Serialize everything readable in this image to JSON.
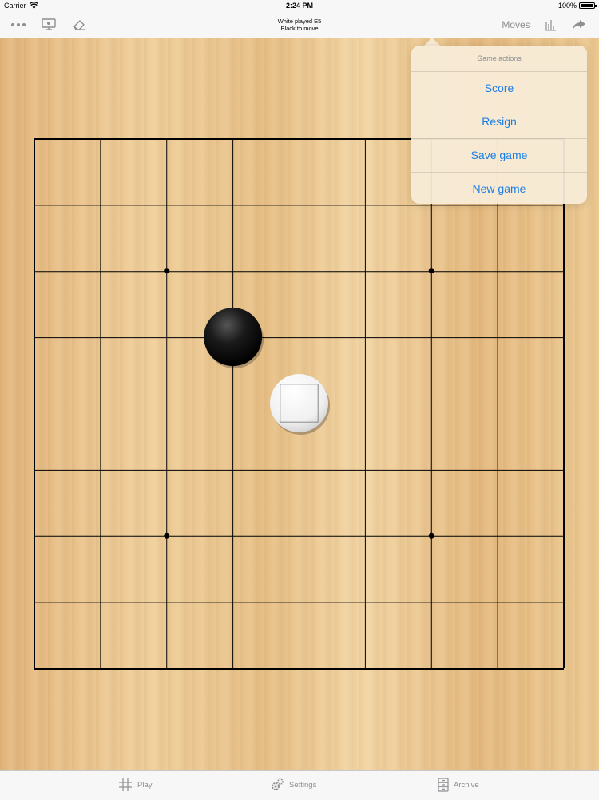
{
  "status_bar": {
    "carrier": "Carrier",
    "time": "2:24 PM",
    "battery": "100%"
  },
  "nav": {
    "title_line1": "White played E5",
    "title_line2": "Black to move",
    "moves_label": "Moves",
    "icons": [
      "more-icon",
      "display-icon",
      "eraser-icon",
      "chart-icon",
      "share-icon"
    ]
  },
  "popover": {
    "header": "Game actions",
    "items": [
      "Score",
      "Resign",
      "Save game",
      "New game"
    ]
  },
  "tabs": {
    "play": "Play",
    "settings": "Settings",
    "archive": "Archive"
  },
  "board": {
    "size": 9,
    "star_points": [
      [
        "C",
        7
      ],
      [
        "G",
        7
      ],
      [
        "C",
        3
      ],
      [
        "G",
        3
      ]
    ],
    "stones": [
      {
        "color": "black",
        "point": "D6"
      },
      {
        "color": "white",
        "point": "E5",
        "last_move": true
      }
    ],
    "colors": {
      "line": "#000000",
      "link": "#1a7ee6"
    }
  }
}
